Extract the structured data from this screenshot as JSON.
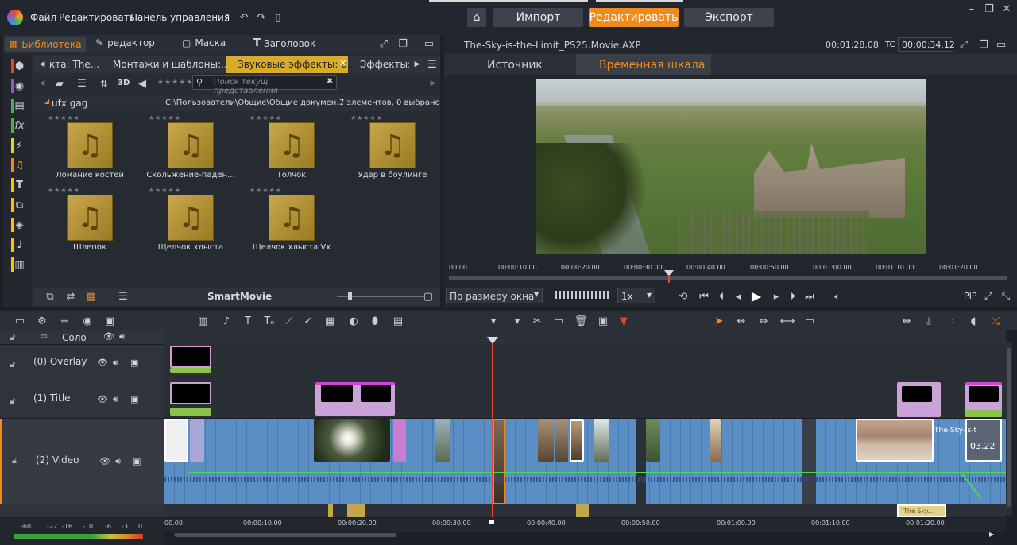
{
  "menu": {
    "file": "Файл",
    "edit": "Редактировать",
    "control_panel": "Панель управления"
  },
  "nav": {
    "import": "Импорт",
    "edit": "Редактировать",
    "export": "Экспорт"
  },
  "lib_tabs": {
    "library": "Библиотека",
    "editor": "редактор",
    "mask": "Маска",
    "title": "Заголовок"
  },
  "lib_subtabs": [
    "кта: The...",
    "Монтажи и шаблоны:...",
    "Звуковые эффекты: u...",
    "Эффекты: С"
  ],
  "threed": "3D",
  "search_placeholder": "Поиск текущ. представления",
  "folder": {
    "name": "ufx gag",
    "path": "C:\\Пользователи\\Общие\\Общие докумен...",
    "count": "7 элементов, 0 выбрано"
  },
  "assets": [
    "Ломание костей",
    "Скольжение-паден...",
    "Толчок",
    "Удар в боулинге",
    "Шлепок",
    "Щелчок хлыста",
    "Щелчок хлыста Vx"
  ],
  "smartmovie": "SmartMovie",
  "preview": {
    "project": "The-Sky-is-the-Limit_PS25.Movie.AXP",
    "duration": "00:01:28.08",
    "tc_label": "TC",
    "tc": "00:00:34.12",
    "tab_source": "Источник",
    "tab_timeline": "Временная шкала",
    "ruler": [
      "00.00",
      "00:00:10.00",
      "00:00:20.00",
      "00:00:30.00",
      "00:00:40.00",
      "00:00:50.00",
      "00:01:00.00",
      "00:01:10.00",
      "00:01:20.00"
    ],
    "fit": "По размеру окна",
    "speed": "1x",
    "pip": "PIP"
  },
  "tracks": {
    "solo": "Соло",
    "overlay": "(0) Overlay",
    "title": "(1) Title",
    "video": "(2) Video"
  },
  "clip_end_text": "The-Sky-is-t",
  "clip_end_time": "03.22",
  "clip_bottom_text": "The Sky...",
  "tl_ruler": [
    "00.00",
    "00:00:10.00",
    "00:00:20.00",
    "00:00:30.00",
    "00:00:40.00",
    "00:00:50.00",
    "00:01:00.00",
    "00:01:10.00",
    "00:01:20.00"
  ],
  "meter": [
    "-60",
    "-22",
    "-16",
    "-10",
    "-6",
    "-3",
    "0"
  ],
  "colors": {
    "accent": "#f08a1c",
    "video_track": "#5b8ec4",
    "title_clip": "#c9a2d6",
    "overlay_bar": "#8bc34a"
  }
}
